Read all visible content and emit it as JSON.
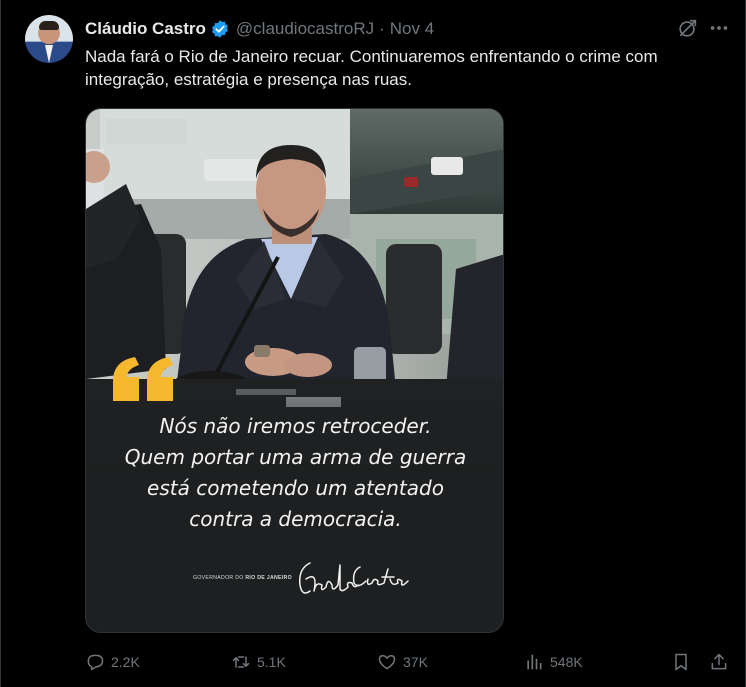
{
  "author": {
    "name": "Cláudio Castro",
    "handle": "@claudiocastroRJ",
    "separator": "·",
    "timestamp": "Nov 4",
    "verified_color": "#1d9bf0"
  },
  "tweet": {
    "text": "Nada fará o Rio de Janeiro recuar. Continuaremos enfrentando o crime com integração, estratégia e presença nas ruas."
  },
  "media": {
    "quote_lines": [
      "Nós não iremos retroceder.",
      "Quem portar uma arma de guerra",
      "está cometendo um atentado",
      "contra a democracia."
    ],
    "caption_prefix": "GOVERNADOR DO ",
    "caption_bold": "RIO DE JANEIRO",
    "signature": "Cláudio Castro",
    "quote_color": "#f5b82e"
  },
  "actions": {
    "replies": "2.2K",
    "reposts": "5.1K",
    "likes": "37K",
    "views": "548K"
  },
  "icons": [
    "verified-icon",
    "grok-icon",
    "more-icon",
    "reply-icon",
    "repost-icon",
    "like-icon",
    "views-icon",
    "bookmark-icon",
    "share-icon"
  ]
}
